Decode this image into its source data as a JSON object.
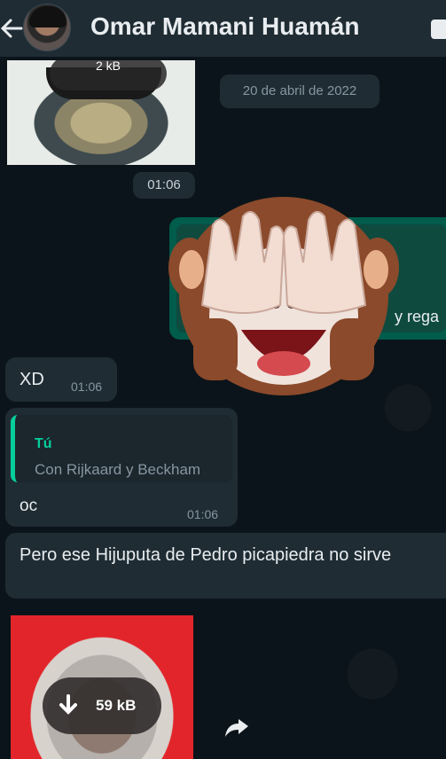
{
  "header": {
    "title": "Omar Mamani Huamán"
  },
  "messages": {
    "top_image": {
      "size_label": "2 kB"
    },
    "date_chip": "20 de abril de 2022",
    "time_chip": "01:06",
    "outgoing_fragment": "y rega",
    "xd": {
      "text": "XD",
      "time": "01:06"
    },
    "reply": {
      "quote_author": "Tú",
      "quote_text": "Con Rijkaard y Beckham",
      "text": "oc",
      "time": "01:06"
    },
    "long_text": "Pero ese Hijuputa de Pedro picapiedra no sirve",
    "bottom_image": {
      "size_label": "59 kB"
    }
  },
  "colors": {
    "header_bg": "#1f2c34",
    "chat_bg": "#0b141a",
    "incoming_bubble": "#1f2c34",
    "outgoing_bubble": "#005c4b",
    "accent": "#06cf9c"
  },
  "icons": [
    "back-arrow-icon",
    "download-icon",
    "forward-icon",
    "see-no-evil-monkey-sticker"
  ]
}
